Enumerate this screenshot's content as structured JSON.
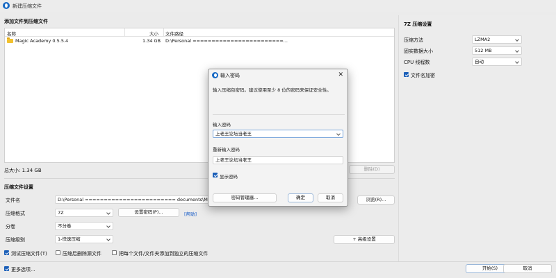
{
  "window": {
    "title": "新建压缩文件"
  },
  "files_section": {
    "title": "添加文件到压缩文件",
    "columns": {
      "name": "名称",
      "size": "大小",
      "path": "文件路径"
    },
    "rows": [
      {
        "name": "Magic Academy 0.5.5.4",
        "size": "1.34 GB",
        "path": "D:\\Personal ========================..."
      }
    ],
    "total_size": "总大小: 1.34 GB",
    "delete_label": "删除(D)"
  },
  "settings_section": {
    "title": "压缩文件设置",
    "filename_label": "文件名",
    "filename_value": "D:\\Personal ======================== documents\\Magic",
    "browse_label": "浏览(R)...",
    "format_label": "压缩格式",
    "format_value": "7Z",
    "set_password_label": "设置密码(P)...",
    "help_label": "[帮助]",
    "split_label": "分卷",
    "split_value": "不分卷",
    "level_label": "压缩级别",
    "level_value": "1-快速压缩",
    "advanced_label": "+ 高级设置",
    "test_label": "测试压缩文件(T)",
    "delete_after_label": "压缩后删除源文件",
    "separate_label": "把每个文件/文件夹添加到独立的压缩文件"
  },
  "bottom": {
    "more_options_label": "更多选项...",
    "start_label": "开始(S)",
    "cancel_label": "取消"
  },
  "seven_z": {
    "title": "7Z 压缩设置",
    "method_label": "压缩方法",
    "method_value": "LZMA2",
    "solid_label": "固实数据大小",
    "solid_value": "512 MB",
    "cpu_label": "CPU 线程数",
    "cpu_value": "自动",
    "encrypt_names_label": "文件名加密"
  },
  "modal": {
    "title": "输入密码",
    "hint": "输入压缩包密码。建议使用至少 8 位的密码来保证安全性。",
    "password_label": "输入密码",
    "password_value": "上老王论坛当老王",
    "reenter_label": "重新输入密码",
    "reenter_value": "上老王论坛当老王",
    "show_password_label": "显示密码",
    "manager_label": "密码管理器...",
    "ok_label": "确定",
    "cancel_label": "取消"
  },
  "colors": {
    "accent": "#1b5fb8",
    "link": "#1c5fc8",
    "folder": "#f2c12e"
  }
}
